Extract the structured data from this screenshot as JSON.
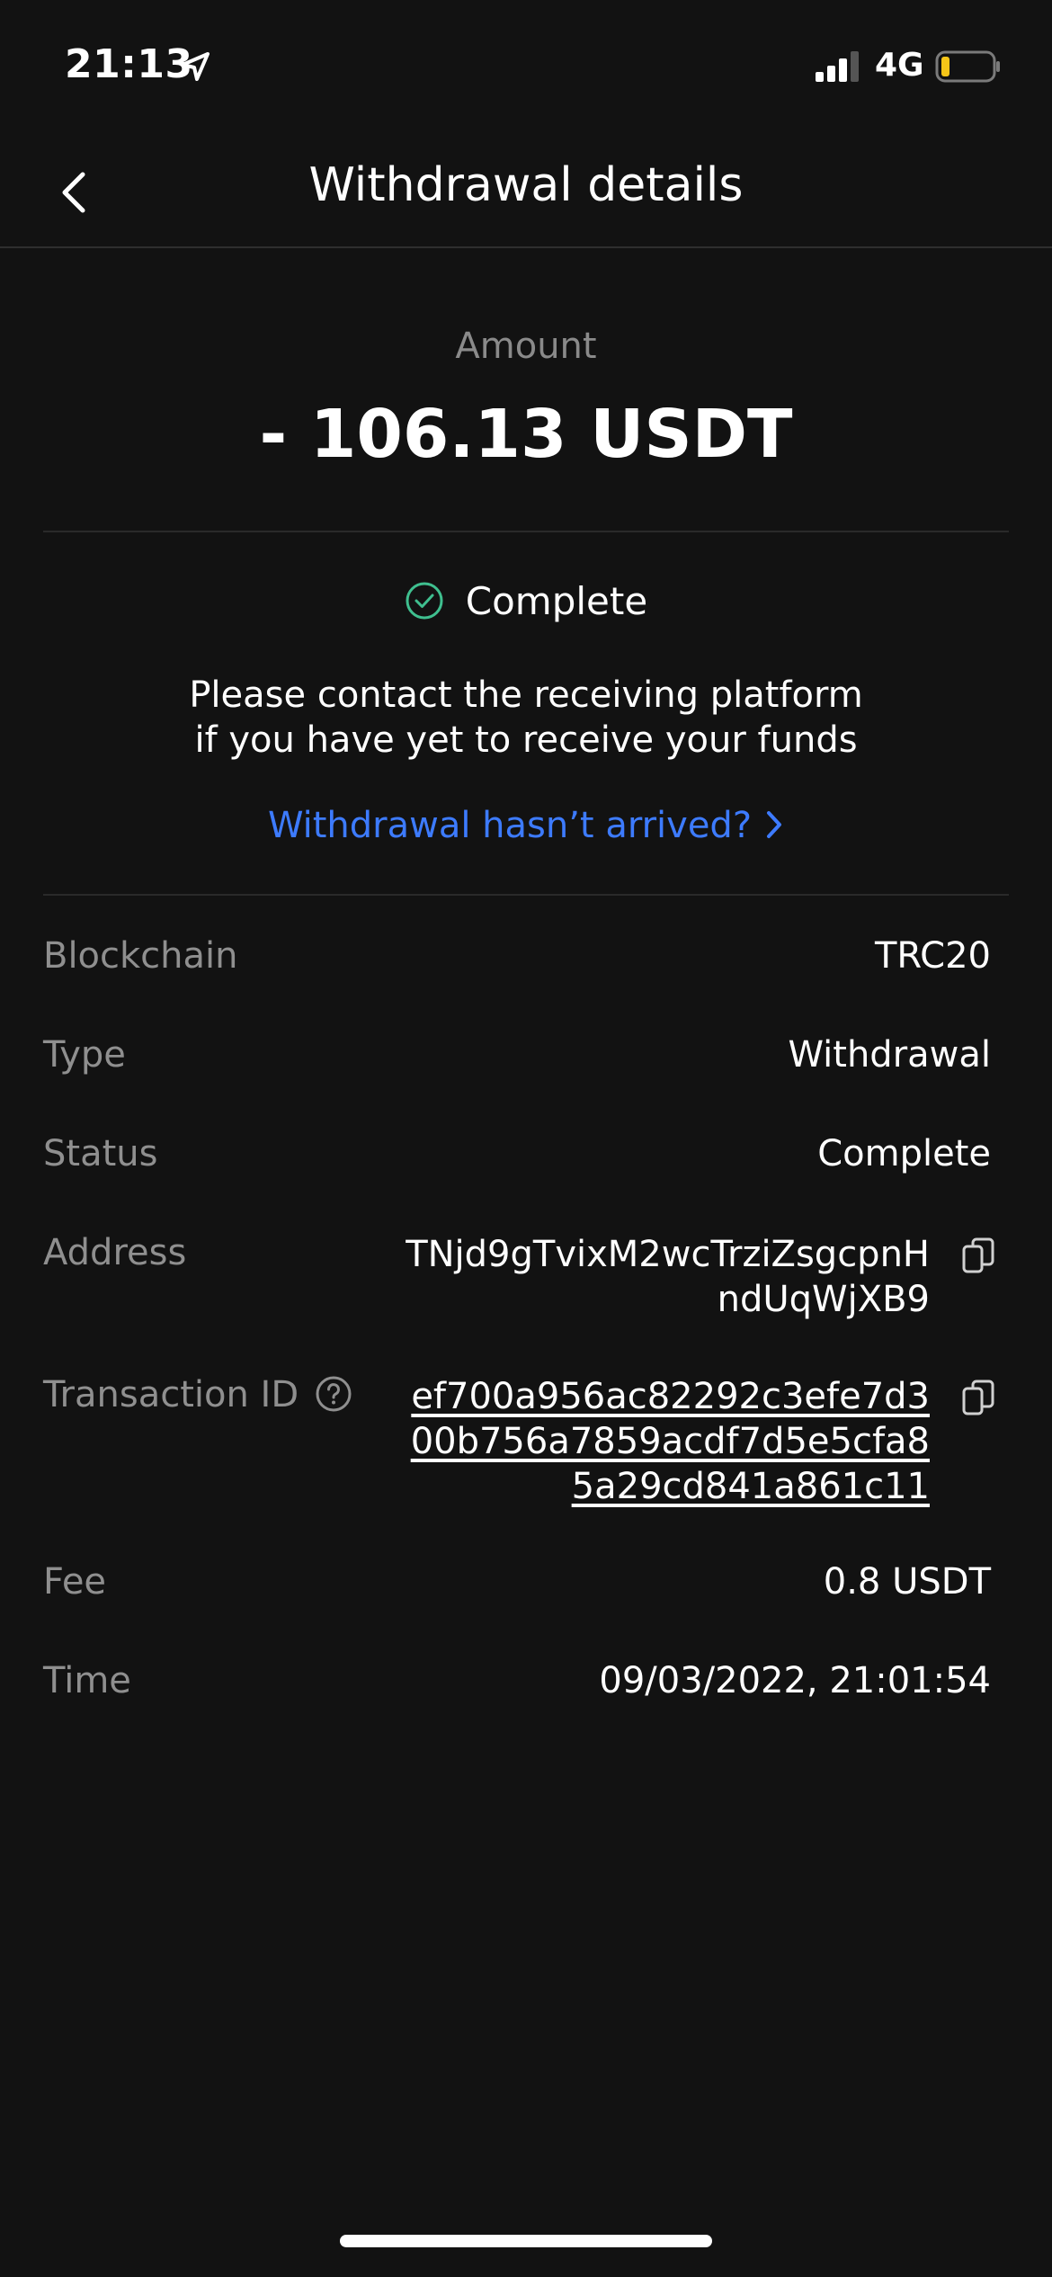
{
  "status_bar": {
    "time": "21:13",
    "network": "4G",
    "battery_color": "#f5c518"
  },
  "nav": {
    "title": "Withdrawal details"
  },
  "amount": {
    "label": "Amount",
    "value": "- 106.13 USDT"
  },
  "status": {
    "label": "Complete",
    "check_color": "#3fbf8f",
    "notice_line1": "Please contact the receiving platform",
    "notice_line2": "if you have yet to receive your funds",
    "help_link": "Withdrawal hasn’t arrived?",
    "link_color": "#3d7bff"
  },
  "details": {
    "blockchain": {
      "label": "Blockchain",
      "value": "TRC20"
    },
    "type": {
      "label": "Type",
      "value": "Withdrawal"
    },
    "status": {
      "label": "Status",
      "value": "Complete"
    },
    "address": {
      "label": "Address",
      "line1": "TNjd9gTvixM2wcTrziZsgcpnH",
      "line2": "ndUqWjXB9"
    },
    "transaction_id": {
      "label": "Transaction ID",
      "line1": "ef700a956ac82292c3efe7d3",
      "line2": "00b756a7859acdf7d5e5cfa8",
      "line3": "5a29cd841a861c11"
    },
    "fee": {
      "label": "Fee",
      "value": "0.8 USDT"
    },
    "time": {
      "label": "Time",
      "value": "09/03/2022, 21:01:54"
    }
  }
}
